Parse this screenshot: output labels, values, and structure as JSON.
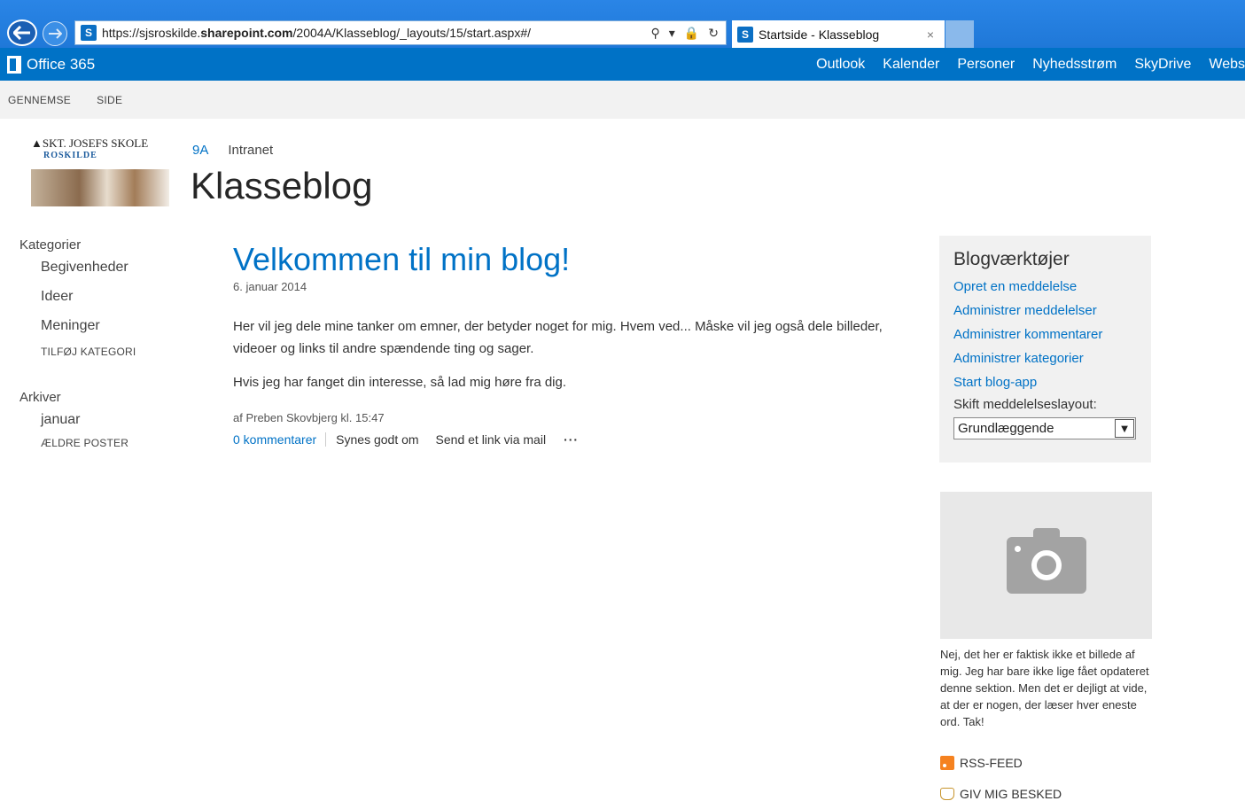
{
  "browser": {
    "url_prefix": "https://sjsroskilde.",
    "url_domain": "sharepoint.com",
    "url_path": "/2004A/Klasseblog/_layouts/15/start.aspx#/",
    "tab_title": "Startside - Klasseblog",
    "tab_close": "×"
  },
  "suite": {
    "brand": "Office 365",
    "links": [
      "Outlook",
      "Kalender",
      "Personer",
      "Nyhedsstrøm",
      "SkyDrive",
      "Webs"
    ]
  },
  "ribbon": {
    "tabs": [
      "GENNEMSE",
      "SIDE"
    ]
  },
  "header": {
    "logo_title": "SKT. JOSEFS SKOLE",
    "logo_sub": "ROSKILDE",
    "breadcrumb_active": "9A",
    "breadcrumb_link": "Intranet",
    "site_title": "Klasseblog"
  },
  "leftnav": {
    "categories_heading": "Kategorier",
    "categories": [
      "Begivenheder",
      "Ideer",
      "Meninger"
    ],
    "add_category": "TILFØJ KATEGORI",
    "archive_heading": "Arkiver",
    "archive_items": [
      "januar"
    ],
    "older_posts": "ÆLDRE POSTER"
  },
  "post": {
    "title": "Velkommen til min blog!",
    "date": "6. januar 2014",
    "paragraph1": "Her vil jeg dele mine tanker om emner, der betyder noget for mig. Hvem ved... Måske vil jeg også dele billeder, videoer og links til andre spændende ting og sager.",
    "paragraph2": "Hvis jeg har fanget din interesse, så lad mig høre fra dig.",
    "meta": "af Preben Skovbjerg kl. 15:47",
    "comments": "0 kommentarer",
    "like": "Synes godt om",
    "mail": "Send et link via mail",
    "more": "···"
  },
  "tools": {
    "title": "Blogværktøjer",
    "links": [
      "Opret en meddelelse",
      "Administrer meddelelser",
      "Administrer kommentarer",
      "Administrer kategorier",
      "Start blog-app"
    ],
    "layout_label": "Skift meddelelseslayout:",
    "layout_value": "Grundlæggende"
  },
  "sidebar": {
    "caption": "Nej, det her er faktisk ikke et billede af mig. Jeg har bare ikke lige fået opdateret denne sektion. Men det er dejligt at vide, at der er nogen, der læser hver eneste ord. Tak!",
    "rss": "RSS-FEED",
    "notify": "GIV MIG BESKED"
  },
  "colors": {
    "accent": "#0072c6",
    "rss": "#f58220"
  }
}
